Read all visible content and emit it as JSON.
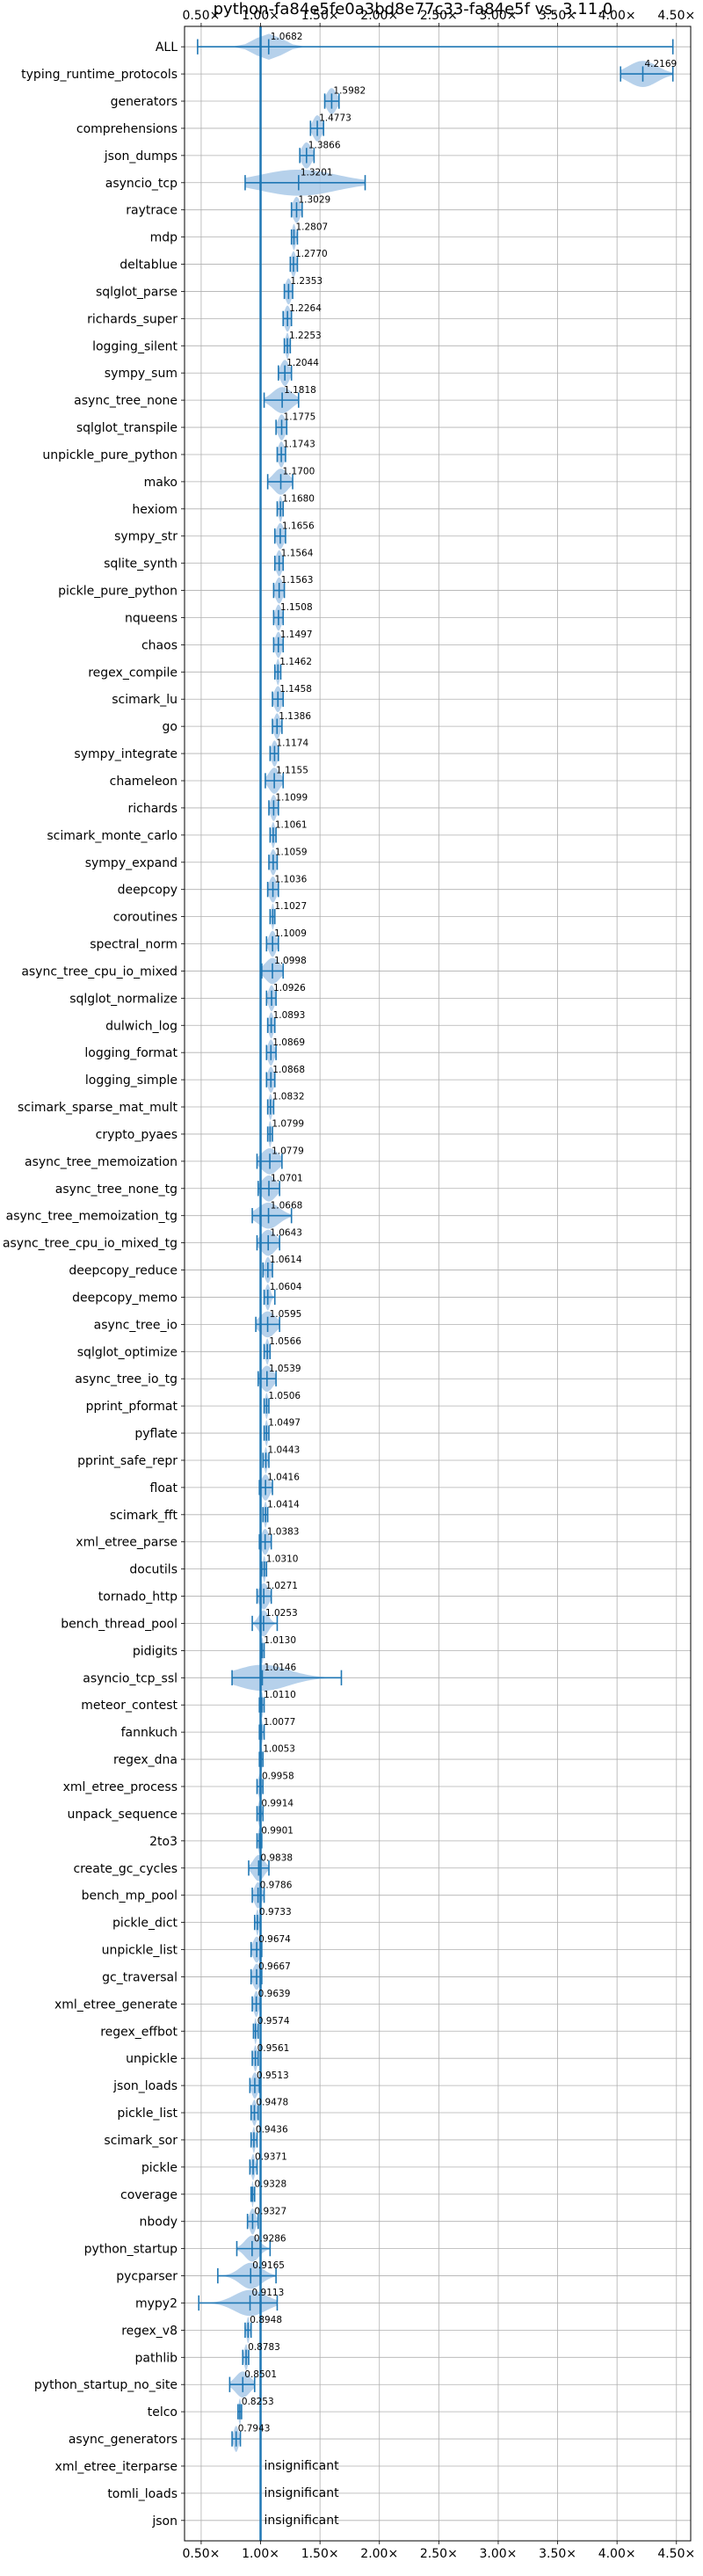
{
  "chart_data": {
    "type": "violin",
    "title": "python-fa84e5fe0a3bd8e77c33-fa84e5f vs. 3.11.0",
    "xlabel": "",
    "ylabel": "",
    "x_ticks": [
      0.5,
      1.0,
      1.5,
      2.0,
      2.5,
      3.0,
      3.5,
      4.0,
      4.5
    ],
    "x_tick_labels": [
      "0.50×",
      "1.00×",
      "1.50×",
      "2.00×",
      "2.50×",
      "3.00×",
      "3.50×",
      "4.00×",
      "4.50×"
    ],
    "xlim": [
      0.36,
      4.62
    ],
    "reference_line": 1.0,
    "grid": true,
    "color": "#1f77b4",
    "violin_fill": "#a9c9e8",
    "insignificant_text": "insignificant",
    "benchmarks": [
      {
        "name": "ALL",
        "label": "1.0682",
        "center": 1.0682,
        "min": 0.47,
        "max": 4.47,
        "spread": 0.11
      },
      {
        "name": "typing_runtime_protocols",
        "label": "4.2169",
        "center": 4.2169,
        "min": 4.03,
        "max": 4.47,
        "spread": 0.12
      },
      {
        "name": "generators",
        "label": "1.5982",
        "center": 1.5982,
        "min": 1.54,
        "max": 1.66,
        "spread": 0.04
      },
      {
        "name": "comprehensions",
        "label": "1.4773",
        "center": 1.4773,
        "min": 1.42,
        "max": 1.53,
        "spread": 0.035
      },
      {
        "name": "json_dumps",
        "label": "1.3866",
        "center": 1.3866,
        "min": 1.33,
        "max": 1.45,
        "spread": 0.04
      },
      {
        "name": "asyncio_tcp",
        "label": "1.3201",
        "center": 1.3201,
        "min": 0.87,
        "max": 1.88,
        "spread": 0.32
      },
      {
        "name": "raytrace",
        "label": "1.3029",
        "center": 1.3029,
        "min": 1.26,
        "max": 1.35,
        "spread": 0.03
      },
      {
        "name": "mdp",
        "label": "1.2807",
        "center": 1.2807,
        "min": 1.26,
        "max": 1.31,
        "spread": 0.015
      },
      {
        "name": "deltablue",
        "label": "1.2770",
        "center": 1.277,
        "min": 1.25,
        "max": 1.31,
        "spread": 0.02
      },
      {
        "name": "sqlglot_parse",
        "label": "1.2353",
        "center": 1.2353,
        "min": 1.2,
        "max": 1.27,
        "spread": 0.025
      },
      {
        "name": "richards_super",
        "label": "1.2264",
        "center": 1.2264,
        "min": 1.19,
        "max": 1.26,
        "spread": 0.025
      },
      {
        "name": "logging_silent",
        "label": "1.2253",
        "center": 1.2253,
        "min": 1.2,
        "max": 1.25,
        "spread": 0.015
      },
      {
        "name": "sympy_sum",
        "label": "1.2044",
        "center": 1.2044,
        "min": 1.15,
        "max": 1.26,
        "spread": 0.035
      },
      {
        "name": "async_tree_none",
        "label": "1.1818",
        "center": 1.1818,
        "min": 1.03,
        "max": 1.32,
        "spread": 0.08
      },
      {
        "name": "sqlglot_transpile",
        "label": "1.1775",
        "center": 1.1775,
        "min": 1.13,
        "max": 1.22,
        "spread": 0.03
      },
      {
        "name": "unpickle_pure_python",
        "label": "1.1743",
        "center": 1.1743,
        "min": 1.14,
        "max": 1.21,
        "spread": 0.025
      },
      {
        "name": "mako",
        "label": "1.1700",
        "center": 1.17,
        "min": 1.06,
        "max": 1.27,
        "spread": 0.06
      },
      {
        "name": "hexiom",
        "label": "1.1680",
        "center": 1.168,
        "min": 1.14,
        "max": 1.19,
        "spread": 0.015
      },
      {
        "name": "sympy_str",
        "label": "1.1656",
        "center": 1.1656,
        "min": 1.12,
        "max": 1.21,
        "spread": 0.03
      },
      {
        "name": "sqlite_synth",
        "label": "1.1564",
        "center": 1.1564,
        "min": 1.12,
        "max": 1.19,
        "spread": 0.025
      },
      {
        "name": "pickle_pure_python",
        "label": "1.1563",
        "center": 1.1563,
        "min": 1.11,
        "max": 1.2,
        "spread": 0.03
      },
      {
        "name": "nqueens",
        "label": "1.1508",
        "center": 1.1508,
        "min": 1.11,
        "max": 1.19,
        "spread": 0.025
      },
      {
        "name": "chaos",
        "label": "1.1497",
        "center": 1.1497,
        "min": 1.11,
        "max": 1.19,
        "spread": 0.025
      },
      {
        "name": "regex_compile",
        "label": "1.1462",
        "center": 1.1462,
        "min": 1.12,
        "max": 1.17,
        "spread": 0.015
      },
      {
        "name": "scimark_lu",
        "label": "1.1458",
        "center": 1.1458,
        "min": 1.1,
        "max": 1.19,
        "spread": 0.03
      },
      {
        "name": "go",
        "label": "1.1386",
        "center": 1.1386,
        "min": 1.1,
        "max": 1.18,
        "spread": 0.025
      },
      {
        "name": "sympy_integrate",
        "label": "1.1174",
        "center": 1.1174,
        "min": 1.08,
        "max": 1.15,
        "spread": 0.025
      },
      {
        "name": "chameleon",
        "label": "1.1155",
        "center": 1.1155,
        "min": 1.04,
        "max": 1.19,
        "spread": 0.045
      },
      {
        "name": "richards",
        "label": "1.1099",
        "center": 1.1099,
        "min": 1.07,
        "max": 1.15,
        "spread": 0.025
      },
      {
        "name": "scimark_monte_carlo",
        "label": "1.1061",
        "center": 1.1061,
        "min": 1.08,
        "max": 1.13,
        "spread": 0.015
      },
      {
        "name": "sympy_expand",
        "label": "1.1059",
        "center": 1.1059,
        "min": 1.07,
        "max": 1.14,
        "spread": 0.025
      },
      {
        "name": "deepcopy",
        "label": "1.1036",
        "center": 1.1036,
        "min": 1.06,
        "max": 1.15,
        "spread": 0.03
      },
      {
        "name": "coroutines",
        "label": "1.1027",
        "center": 1.1027,
        "min": 1.08,
        "max": 1.12,
        "spread": 0.012
      },
      {
        "name": "spectral_norm",
        "label": "1.1009",
        "center": 1.1009,
        "min": 1.05,
        "max": 1.15,
        "spread": 0.03
      },
      {
        "name": "async_tree_cpu_io_mixed",
        "label": "1.0998",
        "center": 1.0998,
        "min": 1.01,
        "max": 1.19,
        "spread": 0.06
      },
      {
        "name": "sqlglot_normalize",
        "label": "1.0926",
        "center": 1.0926,
        "min": 1.05,
        "max": 1.13,
        "spread": 0.025
      },
      {
        "name": "dulwich_log",
        "label": "1.0893",
        "center": 1.0893,
        "min": 1.06,
        "max": 1.12,
        "spread": 0.02
      },
      {
        "name": "logging_format",
        "label": "1.0869",
        "center": 1.0869,
        "min": 1.05,
        "max": 1.13,
        "spread": 0.025
      },
      {
        "name": "logging_simple",
        "label": "1.0868",
        "center": 1.0868,
        "min": 1.05,
        "max": 1.12,
        "spread": 0.025
      },
      {
        "name": "scimark_sparse_mat_mult",
        "label": "1.0832",
        "center": 1.0832,
        "min": 1.06,
        "max": 1.11,
        "spread": 0.015
      },
      {
        "name": "crypto_pyaes",
        "label": "1.0799",
        "center": 1.0799,
        "min": 1.06,
        "max": 1.1,
        "spread": 0.012
      },
      {
        "name": "async_tree_memoization",
        "label": "1.0779",
        "center": 1.0779,
        "min": 0.97,
        "max": 1.18,
        "spread": 0.07
      },
      {
        "name": "async_tree_none_tg",
        "label": "1.0701",
        "center": 1.0701,
        "min": 0.98,
        "max": 1.16,
        "spread": 0.06
      },
      {
        "name": "async_tree_memoization_tg",
        "label": "1.0668",
        "center": 1.0668,
        "min": 0.93,
        "max": 1.26,
        "spread": 0.09
      },
      {
        "name": "async_tree_cpu_io_mixed_tg",
        "label": "1.0643",
        "center": 1.0643,
        "min": 0.97,
        "max": 1.16,
        "spread": 0.06
      },
      {
        "name": "deepcopy_reduce",
        "label": "1.0614",
        "center": 1.0614,
        "min": 1.02,
        "max": 1.1,
        "spread": 0.025
      },
      {
        "name": "deepcopy_memo",
        "label": "1.0604",
        "center": 1.0604,
        "min": 1.03,
        "max": 1.12,
        "spread": 0.02
      },
      {
        "name": "async_tree_io",
        "label": "1.0595",
        "center": 1.0595,
        "min": 0.96,
        "max": 1.16,
        "spread": 0.065
      },
      {
        "name": "sqlglot_optimize",
        "label": "1.0566",
        "center": 1.0566,
        "min": 1.03,
        "max": 1.08,
        "spread": 0.015
      },
      {
        "name": "async_tree_io_tg",
        "label": "1.0539",
        "center": 1.0539,
        "min": 0.98,
        "max": 1.13,
        "spread": 0.05
      },
      {
        "name": "pprint_pformat",
        "label": "1.0506",
        "center": 1.0506,
        "min": 1.03,
        "max": 1.07,
        "spread": 0.012
      },
      {
        "name": "pyflate",
        "label": "1.0497",
        "center": 1.0497,
        "min": 1.03,
        "max": 1.07,
        "spread": 0.012
      },
      {
        "name": "pprint_safe_repr",
        "label": "1.0443",
        "center": 1.0443,
        "min": 1.02,
        "max": 1.07,
        "spread": 0.012
      },
      {
        "name": "float",
        "label": "1.0416",
        "center": 1.0416,
        "min": 0.99,
        "max": 1.1,
        "spread": 0.035
      },
      {
        "name": "scimark_fft",
        "label": "1.0414",
        "center": 1.0414,
        "min": 1.02,
        "max": 1.06,
        "spread": 0.012
      },
      {
        "name": "xml_etree_parse",
        "label": "1.0383",
        "center": 1.0383,
        "min": 0.99,
        "max": 1.09,
        "spread": 0.03
      },
      {
        "name": "docutils",
        "label": "1.0310",
        "center": 1.031,
        "min": 1.01,
        "max": 1.05,
        "spread": 0.012
      },
      {
        "name": "tornado_http",
        "label": "1.0271",
        "center": 1.0271,
        "min": 0.97,
        "max": 1.09,
        "spread": 0.04
      },
      {
        "name": "bench_thread_pool",
        "label": "1.0253",
        "center": 1.0253,
        "min": 0.93,
        "max": 1.14,
        "spread": 0.04
      },
      {
        "name": "pidigits",
        "label": "1.0130",
        "center": 1.013,
        "min": 1.0,
        "max": 1.03,
        "spread": 0.01
      },
      {
        "name": "asyncio_tcp_ssl",
        "label": "1.0146",
        "center": 1.0146,
        "min": 0.76,
        "max": 1.68,
        "spread": 0.22
      },
      {
        "name": "meteor_contest",
        "label": "1.0110",
        "center": 1.011,
        "min": 0.99,
        "max": 1.03,
        "spread": 0.01
      },
      {
        "name": "fannkuch",
        "label": "1.0077",
        "center": 1.0077,
        "min": 0.99,
        "max": 1.03,
        "spread": 0.01
      },
      {
        "name": "regex_dna",
        "label": "1.0053",
        "center": 1.0053,
        "min": 0.99,
        "max": 1.02,
        "spread": 0.01
      },
      {
        "name": "xml_etree_process",
        "label": "0.9958",
        "center": 0.9958,
        "min": 0.97,
        "max": 1.02,
        "spread": 0.015
      },
      {
        "name": "unpack_sequence",
        "label": "0.9914",
        "center": 0.9914,
        "min": 0.97,
        "max": 1.02,
        "spread": 0.012
      },
      {
        "name": "2to3",
        "label": "0.9901",
        "center": 0.9901,
        "min": 0.97,
        "max": 1.01,
        "spread": 0.01
      },
      {
        "name": "create_gc_cycles",
        "label": "0.9838",
        "center": 0.9838,
        "min": 0.9,
        "max": 1.07,
        "spread": 0.045
      },
      {
        "name": "bench_mp_pool",
        "label": "0.9786",
        "center": 0.9786,
        "min": 0.93,
        "max": 1.03,
        "spread": 0.03
      },
      {
        "name": "pickle_dict",
        "label": "0.9733",
        "center": 0.9733,
        "min": 0.95,
        "max": 1.0,
        "spread": 0.012
      },
      {
        "name": "unpickle_list",
        "label": "0.9674",
        "center": 0.9674,
        "min": 0.92,
        "max": 1.01,
        "spread": 0.03
      },
      {
        "name": "gc_traversal",
        "label": "0.9667",
        "center": 0.9667,
        "min": 0.92,
        "max": 1.01,
        "spread": 0.03
      },
      {
        "name": "xml_etree_generate",
        "label": "0.9639",
        "center": 0.9639,
        "min": 0.93,
        "max": 1.0,
        "spread": 0.02
      },
      {
        "name": "regex_effbot",
        "label": "0.9574",
        "center": 0.9574,
        "min": 0.94,
        "max": 0.98,
        "spread": 0.01
      },
      {
        "name": "unpickle",
        "label": "0.9561",
        "center": 0.9561,
        "min": 0.93,
        "max": 0.98,
        "spread": 0.015
      },
      {
        "name": "json_loads",
        "label": "0.9513",
        "center": 0.9513,
        "min": 0.91,
        "max": 0.99,
        "spread": 0.025
      },
      {
        "name": "pickle_list",
        "label": "0.9478",
        "center": 0.9478,
        "min": 0.92,
        "max": 0.98,
        "spread": 0.02
      },
      {
        "name": "scimark_sor",
        "label": "0.9436",
        "center": 0.9436,
        "min": 0.92,
        "max": 0.97,
        "spread": 0.012
      },
      {
        "name": "pickle",
        "label": "0.9371",
        "center": 0.9371,
        "min": 0.91,
        "max": 0.97,
        "spread": 0.015
      },
      {
        "name": "coverage",
        "label": "0.9328",
        "center": 0.9328,
        "min": 0.92,
        "max": 0.95,
        "spread": 0.008
      },
      {
        "name": "nbody",
        "label": "0.9327",
        "center": 0.9327,
        "min": 0.89,
        "max": 0.98,
        "spread": 0.025
      },
      {
        "name": "python_startup",
        "label": "0.9286",
        "center": 0.9286,
        "min": 0.8,
        "max": 1.08,
        "spread": 0.06
      },
      {
        "name": "pycparser",
        "label": "0.9165",
        "center": 0.9165,
        "min": 0.64,
        "max": 1.13,
        "spread": 0.09
      },
      {
        "name": "mypy2",
        "label": "0.9113",
        "center": 0.9113,
        "min": 0.48,
        "max": 1.14,
        "spread": 0.13
      },
      {
        "name": "regex_v8",
        "label": "0.8948",
        "center": 0.8948,
        "min": 0.87,
        "max": 0.92,
        "spread": 0.012
      },
      {
        "name": "pathlib",
        "label": "0.8783",
        "center": 0.8783,
        "min": 0.85,
        "max": 0.9,
        "spread": 0.015
      },
      {
        "name": "python_startup_no_site",
        "label": "0.8501",
        "center": 0.8501,
        "min": 0.74,
        "max": 0.95,
        "spread": 0.06
      },
      {
        "name": "telco",
        "label": "0.8253",
        "center": 0.8253,
        "min": 0.81,
        "max": 0.84,
        "spread": 0.01
      },
      {
        "name": "async_generators",
        "label": "0.7943",
        "center": 0.7943,
        "min": 0.76,
        "max": 0.83,
        "spread": 0.02
      },
      {
        "name": "xml_etree_iterparse",
        "label": "insignificant",
        "insignificant": true
      },
      {
        "name": "tomli_loads",
        "label": "insignificant",
        "insignificant": true
      },
      {
        "name": "json",
        "label": "insignificant",
        "insignificant": true
      }
    ]
  }
}
